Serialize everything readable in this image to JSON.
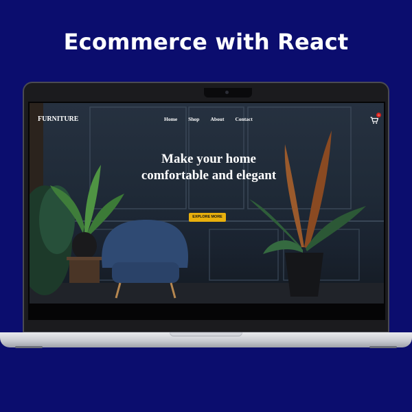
{
  "promo": {
    "title": "Ecommerce with React"
  },
  "site": {
    "brand": "FURNITURE",
    "nav": [
      {
        "label": "Home"
      },
      {
        "label": "Shop"
      },
      {
        "label": "About"
      },
      {
        "label": "Contact"
      }
    ],
    "cart": {
      "icon": "cart-icon",
      "count": "0"
    },
    "hero": {
      "heading_line1": "Make your home",
      "heading_line2": "comfortable and elegant",
      "cta_label": "EXPLORE MORE"
    }
  },
  "colors": {
    "page_background": "#0b0d6e",
    "cta": "#e9b00d",
    "cart_badge": "#d9221c",
    "wall": "#263140"
  }
}
